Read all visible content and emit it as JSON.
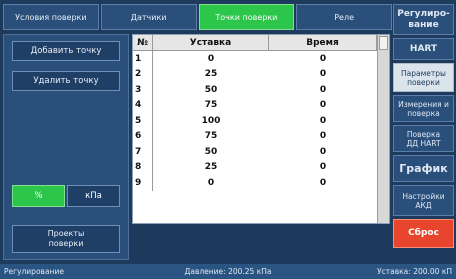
{
  "tabs": [
    {
      "label": "Условия поверки",
      "active": false
    },
    {
      "label": "Датчики",
      "active": false
    },
    {
      "label": "Точки поверки",
      "active": true
    },
    {
      "label": "Реле",
      "active": false
    }
  ],
  "left_panel": {
    "add_point": "Добавить точку",
    "delete_point": "Удалить точку",
    "unit_percent": "%",
    "unit_kpa": "кПа",
    "projects": "Проекты\nповерки"
  },
  "table": {
    "headers": [
      "№",
      "Уставка",
      "Время"
    ],
    "rows": [
      [
        "1",
        "0",
        "0"
      ],
      [
        "2",
        "25",
        "0"
      ],
      [
        "3",
        "50",
        "0"
      ],
      [
        "4",
        "75",
        "0"
      ],
      [
        "5",
        "100",
        "0"
      ],
      [
        "6",
        "75",
        "0"
      ],
      [
        "7",
        "50",
        "0"
      ],
      [
        "8",
        "25",
        "0"
      ],
      [
        "9",
        "0",
        "0"
      ]
    ]
  },
  "right_menu": {
    "regulation": "Регулиро-\nвание",
    "hart": "HART",
    "verify_params": "Параметры\nповерки",
    "measure_verify": "Измерения и\nповерка",
    "verify_dd_hart": "Поверка\nДД HART",
    "graph": "График",
    "adc_settings": "Настройки\nАКД",
    "reset": "Сброс"
  },
  "status": {
    "mode": "Регулирование",
    "pressure": "Давление: 200.25 кПа",
    "setpoint": "Уставка: 200.00 кП"
  }
}
